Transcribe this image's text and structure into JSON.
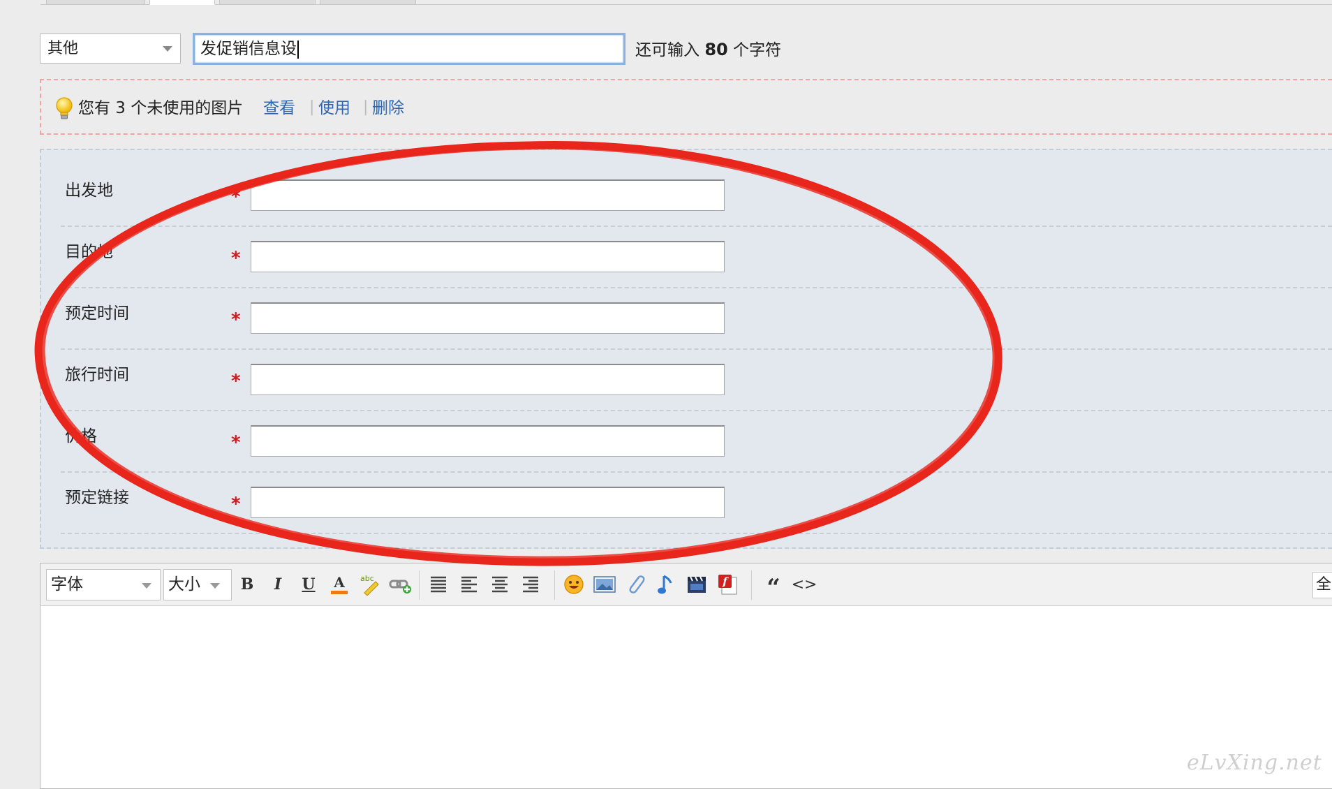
{
  "category": {
    "selected": "其他"
  },
  "title_input": {
    "value": "发促销信息设"
  },
  "char_count": {
    "prefix": "还可输入",
    "count": "80",
    "suffix": "个字符"
  },
  "notice": {
    "text": "您有 3 个未使用的图片",
    "view": "查看",
    "use": "使用",
    "delete": "删除",
    "separator": "|"
  },
  "fields": [
    {
      "label": "出发地",
      "required": "*"
    },
    {
      "label": "目的地",
      "required": "*"
    },
    {
      "label": "预定时间",
      "required": "*"
    },
    {
      "label": "旅行时间",
      "required": "*"
    },
    {
      "label": "价格",
      "required": "*"
    },
    {
      "label": "预定链接",
      "required": "*"
    }
  ],
  "editor": {
    "font_select": "字体",
    "size_select": "大小",
    "bold": "B",
    "italic": "I",
    "underline": "U",
    "font_color": "A",
    "quote": "“",
    "code": "<>",
    "fullscreen": "全"
  },
  "watermark": "eLvXing.net",
  "colors": {
    "link": "#2f66b0",
    "required": "#d2191b",
    "annotation": "#e8261c",
    "panel_bg": "#e3e8ef"
  }
}
